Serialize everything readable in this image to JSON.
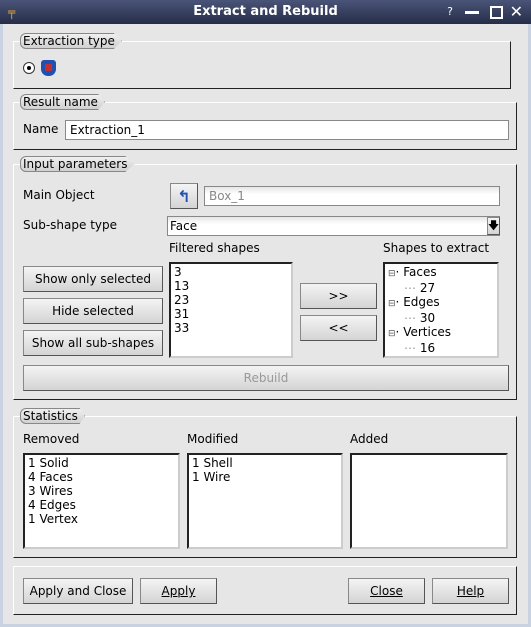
{
  "window": {
    "title": "Extract and Rebuild",
    "controls": [
      "?",
      "minimize",
      "maximize",
      "close"
    ]
  },
  "extraction_type": {
    "label": "Extraction type",
    "selected": true,
    "icon": "extract-shape-icon"
  },
  "result_name": {
    "label": "Result name",
    "name_label": "Name",
    "name_value": "Extraction_1"
  },
  "input": {
    "label": "Input parameters",
    "main_object_label": "Main Object",
    "main_object_value": "Box_1",
    "subshape_label": "Sub-shape type",
    "subshape_value": "Face",
    "filtered_label": "Filtered shapes",
    "filtered": [
      "3",
      "13",
      "23",
      "31",
      "33"
    ],
    "extract_label": "Shapes to extract",
    "tree": [
      {
        "group": "Faces",
        "items": [
          "27"
        ]
      },
      {
        "group": "Edges",
        "items": [
          "30"
        ]
      },
      {
        "group": "Vertices",
        "items": [
          "16"
        ]
      }
    ],
    "show_only_selected": "Show only selected",
    "hide_selected": "Hide selected",
    "show_all": "Show all sub-shapes",
    "add": ">>",
    "remove": "<<",
    "rebuild": "Rebuild"
  },
  "statistics": {
    "label": "Statistics",
    "removed_label": "Removed",
    "modified_label": "Modified",
    "added_label": "Added",
    "removed": [
      "1 Solid",
      "4 Faces",
      "3 Wires",
      "4 Edges",
      "1 Vertex"
    ],
    "modified": [
      "1 Shell",
      "1 Wire"
    ],
    "added": []
  },
  "buttons": {
    "apply_close": "Apply and Close",
    "apply": "Apply",
    "close": "Close",
    "help": "Help"
  }
}
